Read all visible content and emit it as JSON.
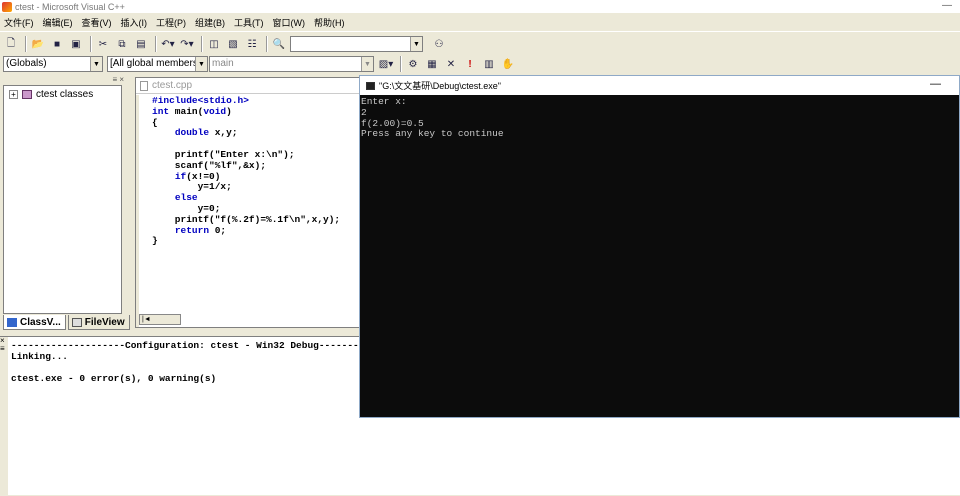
{
  "window": {
    "title": "ctest - Microsoft Visual C++",
    "minimize": "—"
  },
  "menu": [
    "文件(F)",
    "编辑(E)",
    "查看(V)",
    "插入(I)",
    "工程(P)",
    "组建(B)",
    "工具(T)",
    "窗口(W)",
    "帮助(H)"
  ],
  "toolbar": {
    "find_combo_value": "",
    "globals_combo": "(Globals)",
    "members_combo": "[All global members",
    "function_combo": "main"
  },
  "classview": {
    "root_label": "ctest classes",
    "expander": "+",
    "tabs": [
      "ClassV...",
      "FileView"
    ],
    "header_glyphs": "≡ ×"
  },
  "editor": {
    "filename": "ctest.cpp",
    "code": [
      {
        "parts": [
          {
            "t": "#include<stdio.h>",
            "kw": true
          }
        ]
      },
      {
        "parts": [
          {
            "t": "int",
            "kw": true
          },
          {
            "t": " main(",
            "kw": false
          },
          {
            "t": "void",
            "kw": true
          },
          {
            "t": ")",
            "kw": false
          }
        ]
      },
      {
        "parts": [
          {
            "t": "{",
            "kw": false
          }
        ]
      },
      {
        "parts": [
          {
            "t": "    ",
            "kw": false
          },
          {
            "t": "double",
            "kw": true
          },
          {
            "t": " x,y;",
            "kw": false
          }
        ]
      },
      {
        "parts": [
          {
            "t": "",
            "kw": false
          }
        ]
      },
      {
        "parts": [
          {
            "t": "    printf(\"Enter x:\\n\");",
            "kw": false
          }
        ]
      },
      {
        "parts": [
          {
            "t": "    scanf(\"%lf\",&x);",
            "kw": false
          }
        ]
      },
      {
        "parts": [
          {
            "t": "    ",
            "kw": false
          },
          {
            "t": "if",
            "kw": true
          },
          {
            "t": "(x!=0)",
            "kw": false
          }
        ]
      },
      {
        "parts": [
          {
            "t": "        y=1/x;",
            "kw": false
          }
        ]
      },
      {
        "parts": [
          {
            "t": "    ",
            "kw": false
          },
          {
            "t": "else",
            "kw": true
          }
        ]
      },
      {
        "parts": [
          {
            "t": "        y=0;",
            "kw": false
          }
        ]
      },
      {
        "parts": [
          {
            "t": "    printf(\"f(%.2f)=%.1f\\n\",x,y);",
            "kw": false
          }
        ]
      },
      {
        "parts": [
          {
            "t": "    ",
            "kw": false
          },
          {
            "t": "return",
            "kw": true
          },
          {
            "t": " 0;",
            "kw": false
          }
        ]
      },
      {
        "parts": [
          {
            "t": "}",
            "kw": false
          }
        ]
      }
    ],
    "scroll_glyph": "|◄"
  },
  "output": {
    "lines": [
      "--------------------Configuration: ctest - Win32 Debug--------------------",
      "Linking...",
      "",
      "ctest.exe - 0 error(s), 0 warning(s)"
    ],
    "edge_glyph": "×\n≡"
  },
  "console": {
    "title": "\"G:\\文文基研\\Debug\\ctest.exe\"",
    "minimize": "—",
    "lines": [
      "Enter x:",
      "2",
      "f(2.00)=0.5",
      "Press any key to continue"
    ]
  }
}
